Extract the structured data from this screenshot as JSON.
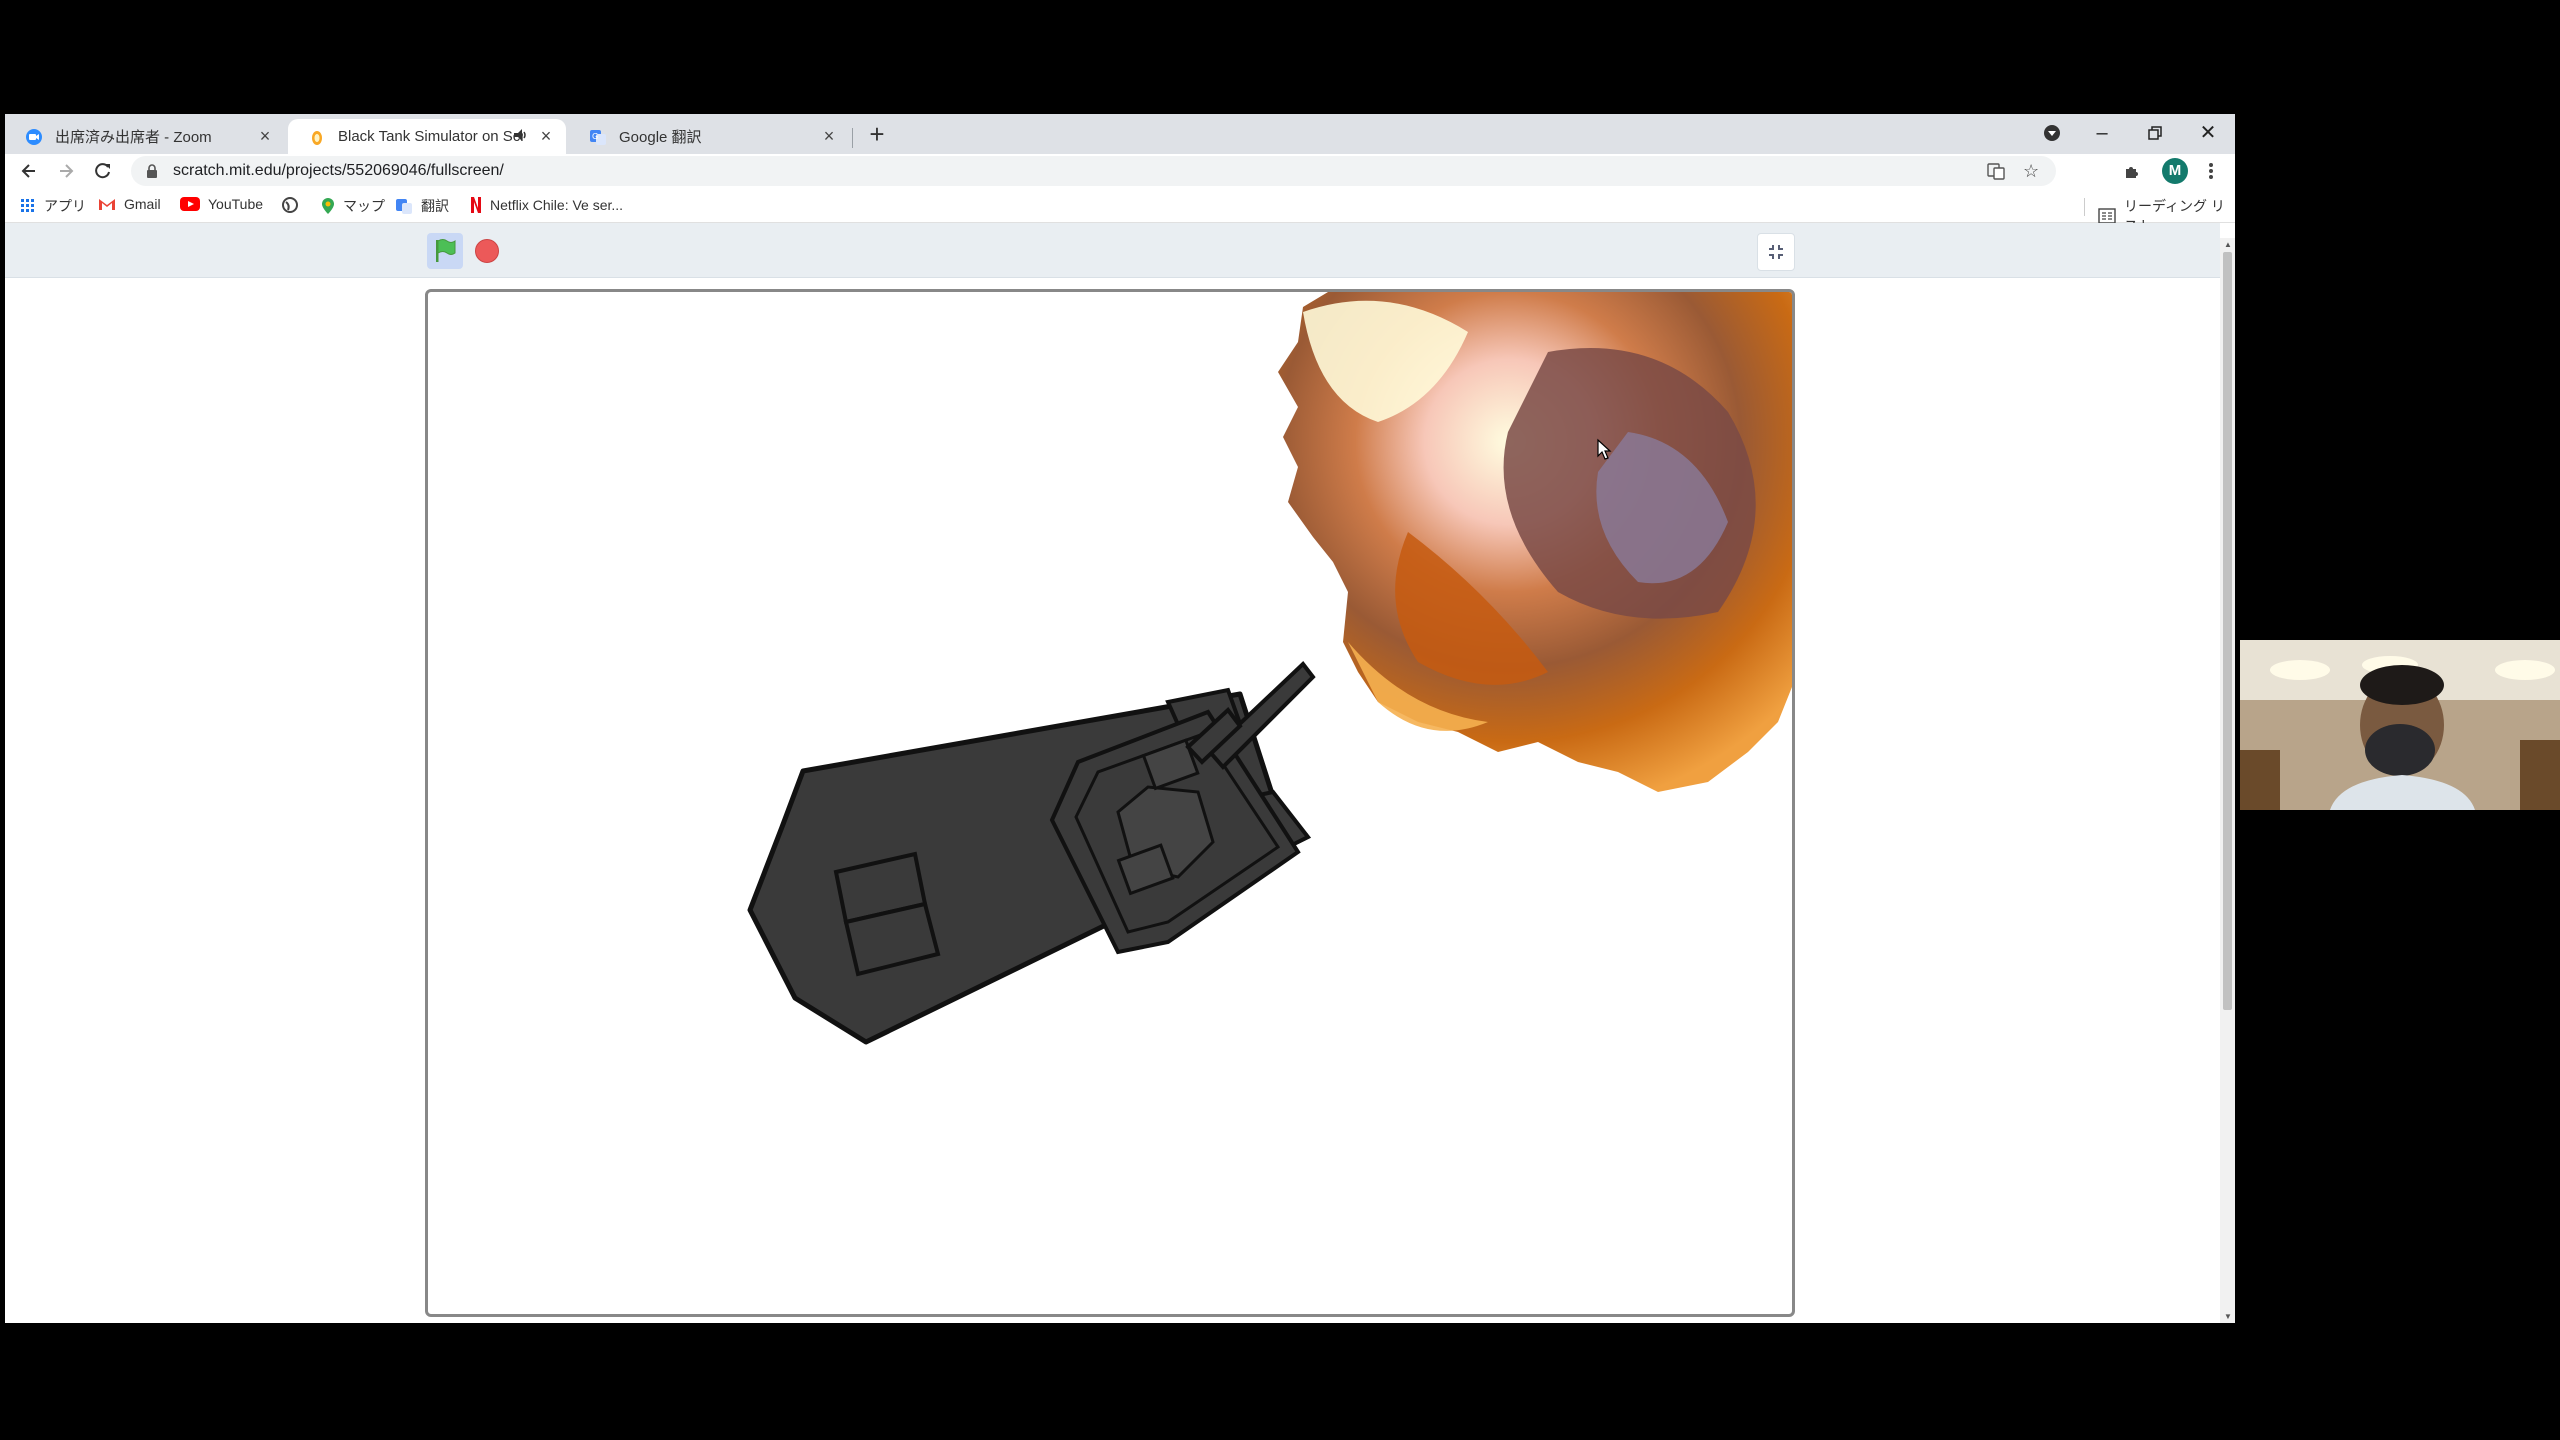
{
  "tabs": [
    {
      "title": "出席済み出席者 - Zoom",
      "favicon": "zoom-icon"
    },
    {
      "title": "Black Tank Simulator on Scra",
      "favicon": "scratch-icon",
      "active": true,
      "audio": true
    },
    {
      "title": "Google 翻訳",
      "favicon": "translate-icon"
    }
  ],
  "address": {
    "url": "scratch.mit.edu/projects/552069046/fullscreen/"
  },
  "profile": {
    "initial": "M"
  },
  "bookmarks": [
    {
      "label": "アプリ",
      "icon": "apps-grid-icon"
    },
    {
      "label": "Gmail",
      "icon": "gmail-icon"
    },
    {
      "label": "YouTube",
      "icon": "youtube-icon"
    },
    {
      "label": "",
      "icon": "globe-icon"
    },
    {
      "label": "マップ",
      "icon": "maps-pin-icon"
    },
    {
      "label": "翻訳",
      "icon": "translate-icon"
    },
    {
      "label": "Netflix Chile: Ve ser...",
      "icon": "netflix-icon"
    }
  ],
  "reading_list": {
    "label": "リーディング リスト"
  },
  "colors": {
    "green_flag": "#4cbf56",
    "stop": "#ec5959",
    "tank": "#3a3a3a"
  }
}
